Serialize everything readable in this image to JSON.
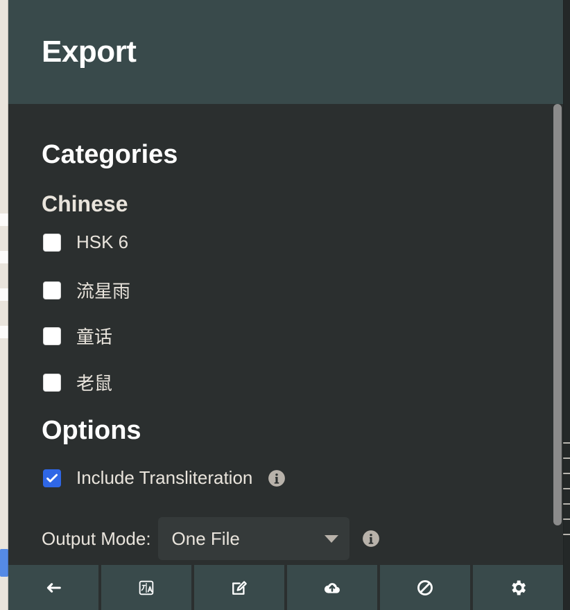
{
  "dialog": {
    "title": "Export"
  },
  "sections": {
    "categories": {
      "heading": "Categories",
      "group": {
        "name": "Chinese",
        "items": [
          {
            "label": "HSK 6",
            "checked": false
          },
          {
            "label": "流星雨",
            "checked": false
          },
          {
            "label": "童话",
            "checked": false
          },
          {
            "label": "老鼠",
            "checked": false
          }
        ]
      }
    },
    "options": {
      "heading": "Options",
      "include_transliteration": {
        "label": "Include Transliteration",
        "checked": true,
        "info_icon": "info-circle-icon"
      },
      "output_mode": {
        "label": "Output Mode:",
        "selected": "One File",
        "info_icon": "info-circle-icon"
      }
    }
  },
  "toolbar": {
    "buttons": [
      {
        "name": "back",
        "icon": "arrow-left-icon"
      },
      {
        "name": "translate",
        "icon": "translate-icon"
      },
      {
        "name": "edit",
        "icon": "edit-icon"
      },
      {
        "name": "upload",
        "icon": "cloud-upload-icon"
      },
      {
        "name": "ban",
        "icon": "ban-icon"
      },
      {
        "name": "settings",
        "icon": "gear-icon"
      }
    ]
  },
  "colors": {
    "header_bg": "#394a4b",
    "panel_bg": "#2b2f2f",
    "text_primary": "#ffffff",
    "text_secondary": "#e9e4dc",
    "checkbox_checked": "#2f67e6",
    "select_bg": "#353a3a",
    "scroll_thumb": "#8b8b8b"
  }
}
